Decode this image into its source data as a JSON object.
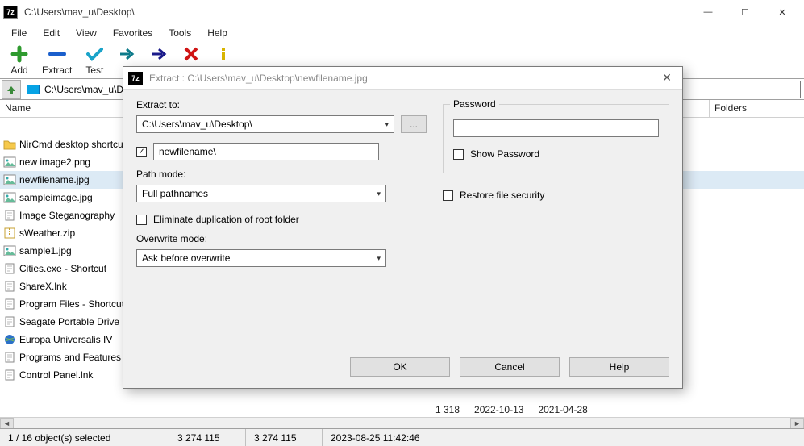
{
  "window": {
    "title": "C:\\Users\\mav_u\\Desktop\\",
    "controls": {
      "min": "—",
      "max": "☐",
      "close": "✕"
    }
  },
  "menu": [
    "File",
    "Edit",
    "View",
    "Favorites",
    "Tools",
    "Help"
  ],
  "toolbar": {
    "add": "Add",
    "extract": "Extract",
    "test": "Test"
  },
  "address": "C:\\Users\\mav_u\\Desktop\\",
  "columns": {
    "name": "Name",
    "folders": "Folders"
  },
  "files": [
    {
      "name": "NirCmd desktop shortcuts",
      "icon": "folder",
      "sel": false
    },
    {
      "name": "new image2.png",
      "icon": "img",
      "sel": false
    },
    {
      "name": "newfilename.jpg",
      "icon": "img",
      "sel": true
    },
    {
      "name": "sampleimage.jpg",
      "icon": "img",
      "sel": false
    },
    {
      "name": "Image Steganography",
      "icon": "file",
      "sel": false
    },
    {
      "name": "sWeather.zip",
      "icon": "zip",
      "sel": false
    },
    {
      "name": "sample1.jpg",
      "icon": "img",
      "sel": false
    },
    {
      "name": "Cities.exe - Shortcut",
      "icon": "file",
      "sel": false
    },
    {
      "name": "ShareX.lnk",
      "icon": "file",
      "sel": false
    },
    {
      "name": "Program Files - Shortcut",
      "icon": "file",
      "sel": false
    },
    {
      "name": "Seagate Portable Drive",
      "icon": "file",
      "sel": false
    },
    {
      "name": "Europa Universalis IV",
      "icon": "globe",
      "sel": false
    },
    {
      "name": "Programs and Features",
      "icon": "file",
      "sel": false
    },
    {
      "name": "Control Panel.lnk",
      "icon": "file",
      "sel": false
    }
  ],
  "dialog": {
    "title": "Extract : C:\\Users\\mav_u\\Desktop\\newfilename.jpg",
    "extract_to_label": "Extract to:",
    "extract_to_value": "C:\\Users\\mav_u\\Desktop\\",
    "browse": "...",
    "subfolder_value": "newfilename\\",
    "path_mode_label": "Path mode:",
    "path_mode_value": "Full pathnames",
    "eliminate_label": "Eliminate duplication of root folder",
    "overwrite_label": "Overwrite mode:",
    "overwrite_value": "Ask before overwrite",
    "password_label": "Password",
    "show_password_label": "Show Password",
    "restore_label": "Restore file security",
    "ok": "OK",
    "cancel": "Cancel",
    "help": "Help"
  },
  "detail": {
    "size": "1 318",
    "date1": "2022-10-13",
    "date2": "2021-04-28"
  },
  "status": {
    "selection": "1 / 16 object(s) selected",
    "v1": "3 274 115",
    "v2": "3 274 115",
    "ts": "2023-08-25 11:42:46"
  }
}
